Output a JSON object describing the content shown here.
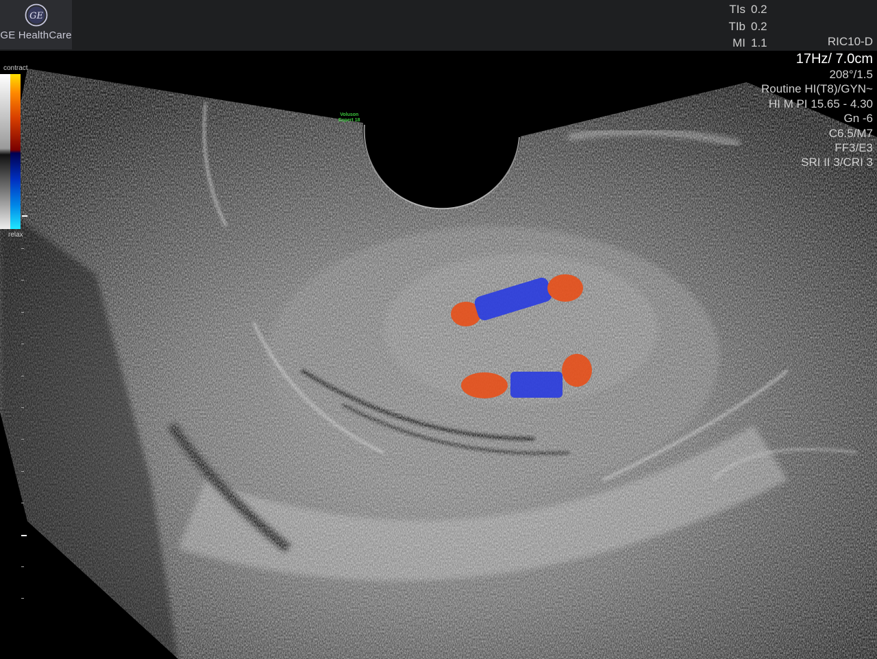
{
  "brand": {
    "name": "GE HealthCare",
    "logo": "ge-monogram-logo"
  },
  "safety": [
    {
      "label": "TIs",
      "value": "0.2"
    },
    {
      "label": "TIb",
      "value": "0.2"
    },
    {
      "label": "MI",
      "value": "1.1"
    }
  ],
  "probe": "RIC10-D",
  "params": {
    "frame_depth": "17Hz/ 7.0cm",
    "angle": "208°/1.5",
    "preset": "Routine HI(T8)/GYN~",
    "harmonic": "HI M PI 15.65 - 4.30",
    "gain": "Gn  -6",
    "contrast": "C6.5/M7",
    "ff": "FF3/E3",
    "sri": "SRI II 3/CRI 3"
  },
  "color_scale": {
    "top_label": "contract",
    "bottom_label": "relax"
  },
  "watermark": {
    "line1": "Voluson",
    "line2": "Expert 18"
  },
  "colors": {
    "contract": "#e8501a",
    "relax": "#2a3ce0",
    "topbar": "#1e1f21",
    "logo_bg": "#2c2d31"
  }
}
